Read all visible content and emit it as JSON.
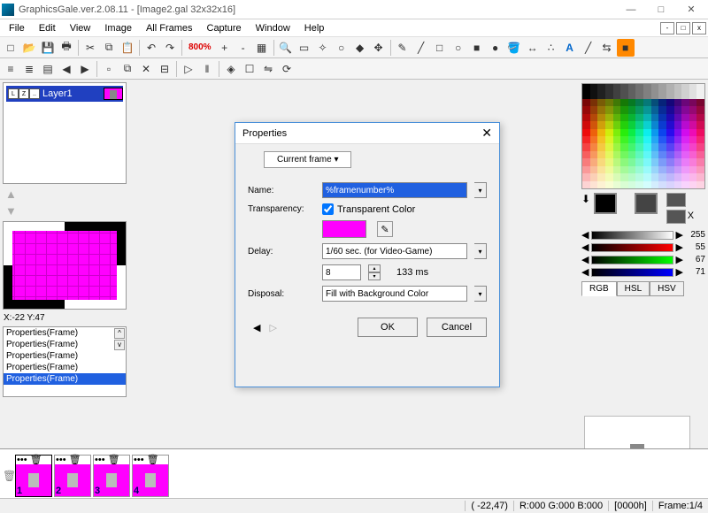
{
  "title": "GraphicsGale.ver.2.08.11 - [Image2.gal 32x32x16]",
  "menu": {
    "file": "File",
    "edit": "Edit",
    "view": "View",
    "image": "Image",
    "allframes": "All Frames",
    "capture": "Capture",
    "window": "Window",
    "help": "Help"
  },
  "zoom": "800%",
  "layer": {
    "name": "Layer1"
  },
  "coords": "X:-22 Y:47",
  "history": {
    "item": "Properties(Frame)"
  },
  "rgb_values": {
    "grey": "255",
    "r": "55",
    "g": "67",
    "b": "71"
  },
  "tabs": {
    "rgb": "RGB",
    "hsl": "HSL",
    "hsv": "HSV"
  },
  "frames": [
    {
      "n": "1"
    },
    {
      "n": "2"
    },
    {
      "n": "3"
    },
    {
      "n": "4"
    }
  ],
  "status": {
    "coord": "( -22,47)",
    "rgb": "R:000 G:000 B:000",
    "hex": "[0000h]",
    "frame": "Frame:1/4"
  },
  "dlg": {
    "title": "Properties",
    "tab": "Current frame ▾",
    "name_lbl": "Name:",
    "name_val": "%framenumber%",
    "trans_lbl": "Transparency:",
    "trans_chk": "Transparent Color",
    "delay_lbl": "Delay:",
    "delay_sel": "1/60 sec. (for Video-Game)",
    "delay_num": "8",
    "delay_ms": "133 ms",
    "disp_lbl": "Disposal:",
    "disp_sel": "Fill with Background Color",
    "ok": "OK",
    "cancel": "Cancel"
  }
}
